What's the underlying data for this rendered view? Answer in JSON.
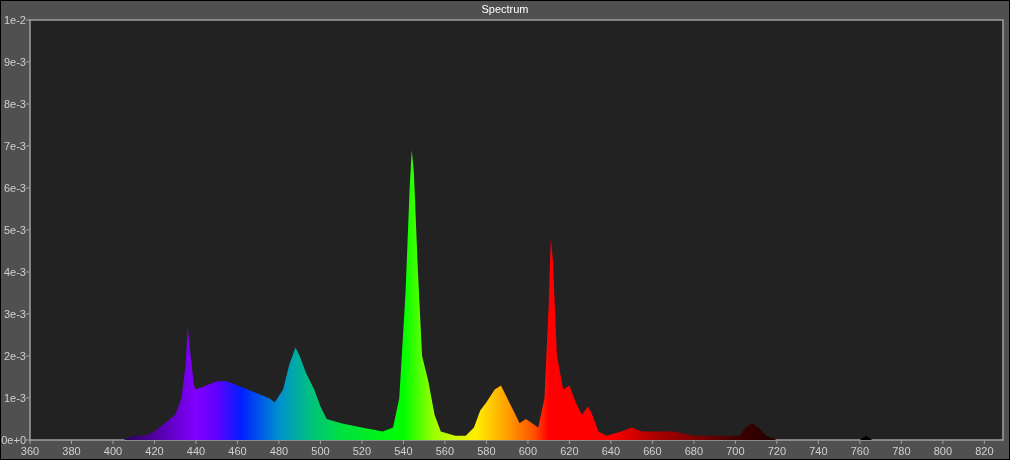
{
  "chart": {
    "title": "Spectrum",
    "chart_data": {
      "type": "area",
      "xlim": [
        360,
        829
      ],
      "ylim": [
        0,
        0.01
      ],
      "xticks": [
        360,
        380,
        400,
        420,
        440,
        460,
        480,
        500,
        520,
        540,
        560,
        580,
        600,
        620,
        640,
        660,
        680,
        700,
        720,
        740,
        760,
        780,
        800,
        820
      ],
      "yticks": [
        {
          "value": 0,
          "label": "0e+0"
        },
        {
          "value": 0.001,
          "label": "1e-3"
        },
        {
          "value": 0.002,
          "label": "2e-3"
        },
        {
          "value": 0.003,
          "label": "3e-3"
        },
        {
          "value": 0.004,
          "label": "4e-3"
        },
        {
          "value": 0.005,
          "label": "5e-3"
        },
        {
          "value": 0.006,
          "label": "6e-3"
        },
        {
          "value": 0.007,
          "label": "7e-3"
        },
        {
          "value": 0.008,
          "label": "8e-3"
        },
        {
          "value": 0.009,
          "label": "9e-3"
        },
        {
          "value": 0.01,
          "label": "1e-2"
        }
      ],
      "x": [
        400,
        405,
        410,
        415,
        420,
        425,
        430,
        433,
        435,
        436,
        437,
        439,
        440,
        445,
        450,
        455,
        460,
        465,
        470,
        475,
        478,
        482,
        485,
        488,
        490,
        493,
        497,
        500,
        503,
        510,
        520,
        530,
        535,
        538,
        541,
        543,
        544,
        545,
        547,
        549,
        552,
        555,
        558,
        565,
        570,
        574,
        577,
        580,
        584,
        587,
        590,
        593,
        596,
        599,
        602,
        605,
        608,
        610,
        611,
        612,
        614,
        617,
        620,
        623,
        626,
        629,
        631,
        634,
        638,
        645,
        650,
        655,
        660,
        670,
        680,
        690,
        698,
        702,
        705,
        708,
        711,
        715,
        720,
        740,
        760,
        763,
        766,
        780
      ],
      "series": [
        {
          "values": [
            0,
            0,
            0.0001,
            0.0001,
            0.0002,
            0.0004,
            0.0006,
            0.001,
            0.0018,
            0.0027,
            0.0022,
            0.0013,
            0.0012,
            0.0013,
            0.0014,
            0.0014,
            0.0013,
            0.0012,
            0.0011,
            0.001,
            0.0009,
            0.0012,
            0.0018,
            0.0022,
            0.002,
            0.0016,
            0.0012,
            0.0008,
            0.0005,
            0.0004,
            0.0003,
            0.0002,
            0.0003,
            0.001,
            0.0035,
            0.006,
            0.0069,
            0.0064,
            0.004,
            0.002,
            0.0014,
            0.0006,
            0.0002,
            0.0001,
            0.0001,
            0.0003,
            0.0007,
            0.0009,
            0.0012,
            0.0013,
            0.001,
            0.0007,
            0.0004,
            0.0005,
            0.0004,
            0.0003,
            0.001,
            0.0032,
            0.0048,
            0.0043,
            0.002,
            0.0012,
            0.0013,
            0.0009,
            0.0006,
            0.0008,
            0.0006,
            0.0002,
            0.0001,
            0.0002,
            0.0003,
            0.0002,
            0.0002,
            0.0002,
            0.0001,
            0.0001,
            0.0001,
            0.0001,
            0.0003,
            0.0004,
            0.0003,
            0.0001,
            0,
            0,
            0,
            0.0001,
            0,
            0
          ]
        }
      ]
    }
  }
}
